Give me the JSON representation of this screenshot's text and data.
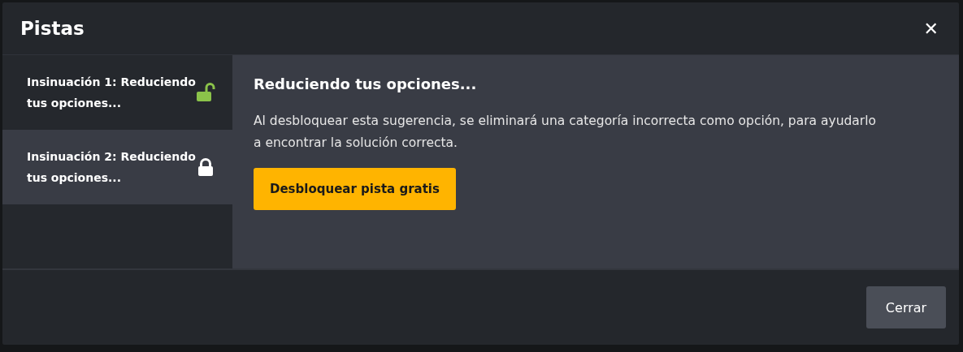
{
  "dialog": {
    "title": "Pistas",
    "close_glyph": "✕"
  },
  "hints": [
    {
      "label": "Insinuación 1: Reduciendo tus opciones...",
      "unlocked": true,
      "selected": false
    },
    {
      "label": "Insinuación 2: Reduciendo tus opciones...",
      "unlocked": false,
      "selected": true
    }
  ],
  "content": {
    "heading": "Reduciendo tus opciones...",
    "text": "Al desbloquear esta sugerencia, se eliminará una categoría incorrecta como opción, para ayudarlo a encontrar la solución correcta.",
    "button": "Desbloquear pista gratis"
  },
  "footer": {
    "button": "Cerrar"
  }
}
